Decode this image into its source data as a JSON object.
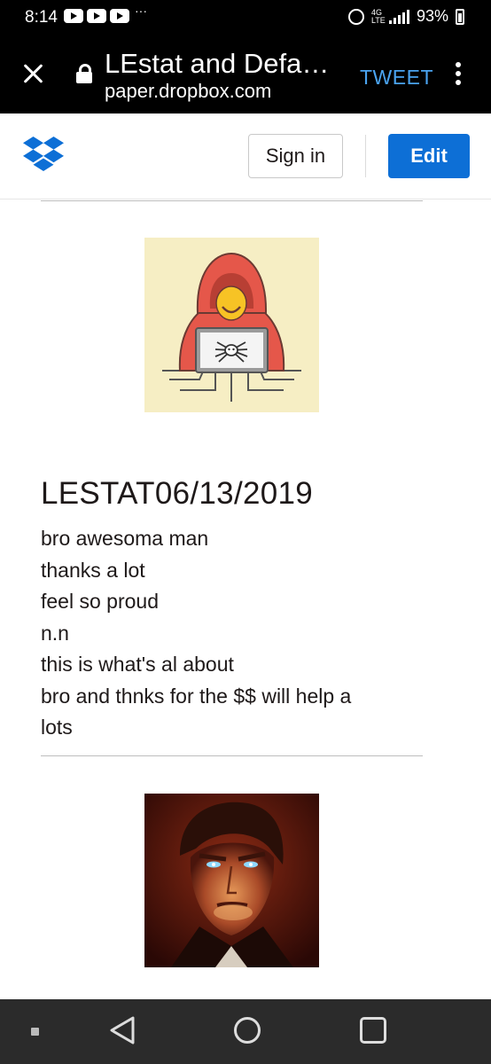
{
  "status_bar": {
    "time": "8:14",
    "more": "···",
    "network": "4G\nLTE",
    "battery": "93%"
  },
  "browser": {
    "page_title": "LEstat and Defa…",
    "url": "paper.dropbox.com",
    "tweet_label": "TWEET"
  },
  "header": {
    "signin_label": "Sign in",
    "edit_label": "Edit",
    "brand_color": "#0d6fd6"
  },
  "post": {
    "heading": "LESTAT06/13/2019",
    "lines": [
      "bro awesoma man",
      "thanks a lot",
      "feel so proud",
      "n.n",
      "this is what's al about",
      "bro and thnks for the $$ will help a",
      "lots"
    ]
  },
  "icons": {
    "close": "close-icon",
    "lock": "lock-icon",
    "menu": "more-vertical-icon",
    "logo": "dropbox-logo-icon",
    "back": "back-triangle-icon",
    "home": "home-circle-icon",
    "recent": "recent-apps-square-icon"
  }
}
